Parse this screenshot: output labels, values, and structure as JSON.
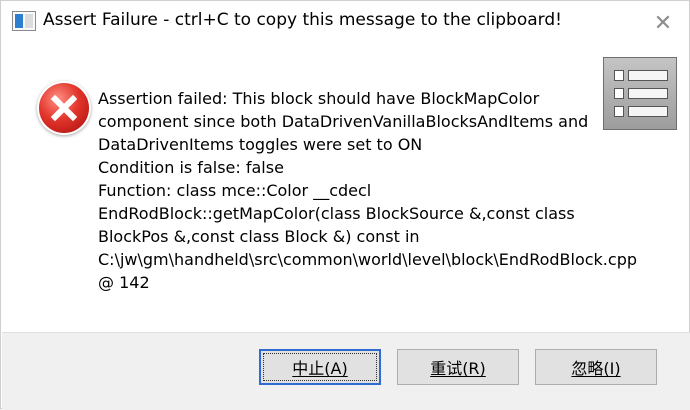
{
  "window": {
    "title": "Assert Failure - ctrl+C to copy this message to the clipboard!",
    "close_glyph": "✕"
  },
  "message": {
    "line1": "Assertion failed: This block should have BlockMapColor component since both DataDrivenVanillaBlocksAndItems and DataDrivenItems toggles were set to ON",
    "line2": "Condition is false: false",
    "line3": "Function: class mce::Color __cdecl EndRodBlock::getMapColor(class BlockSource &,const class BlockPos &,const class Block &) const in C:\\jw\\gm\\handheld\\src\\common\\world\\level\\block\\EndRodBlock.cpp @ 142"
  },
  "icons": {
    "error": "error-icon",
    "app": "window-app-icon",
    "side": "list-image-icon"
  },
  "buttons": {
    "abort": "中止(A)",
    "retry": "重试(R)",
    "ignore": "忽略(I)"
  },
  "colors": {
    "accent": "#2f6bd1",
    "error_red": "#e2352b",
    "footer_bg": "#f0f0f0"
  }
}
